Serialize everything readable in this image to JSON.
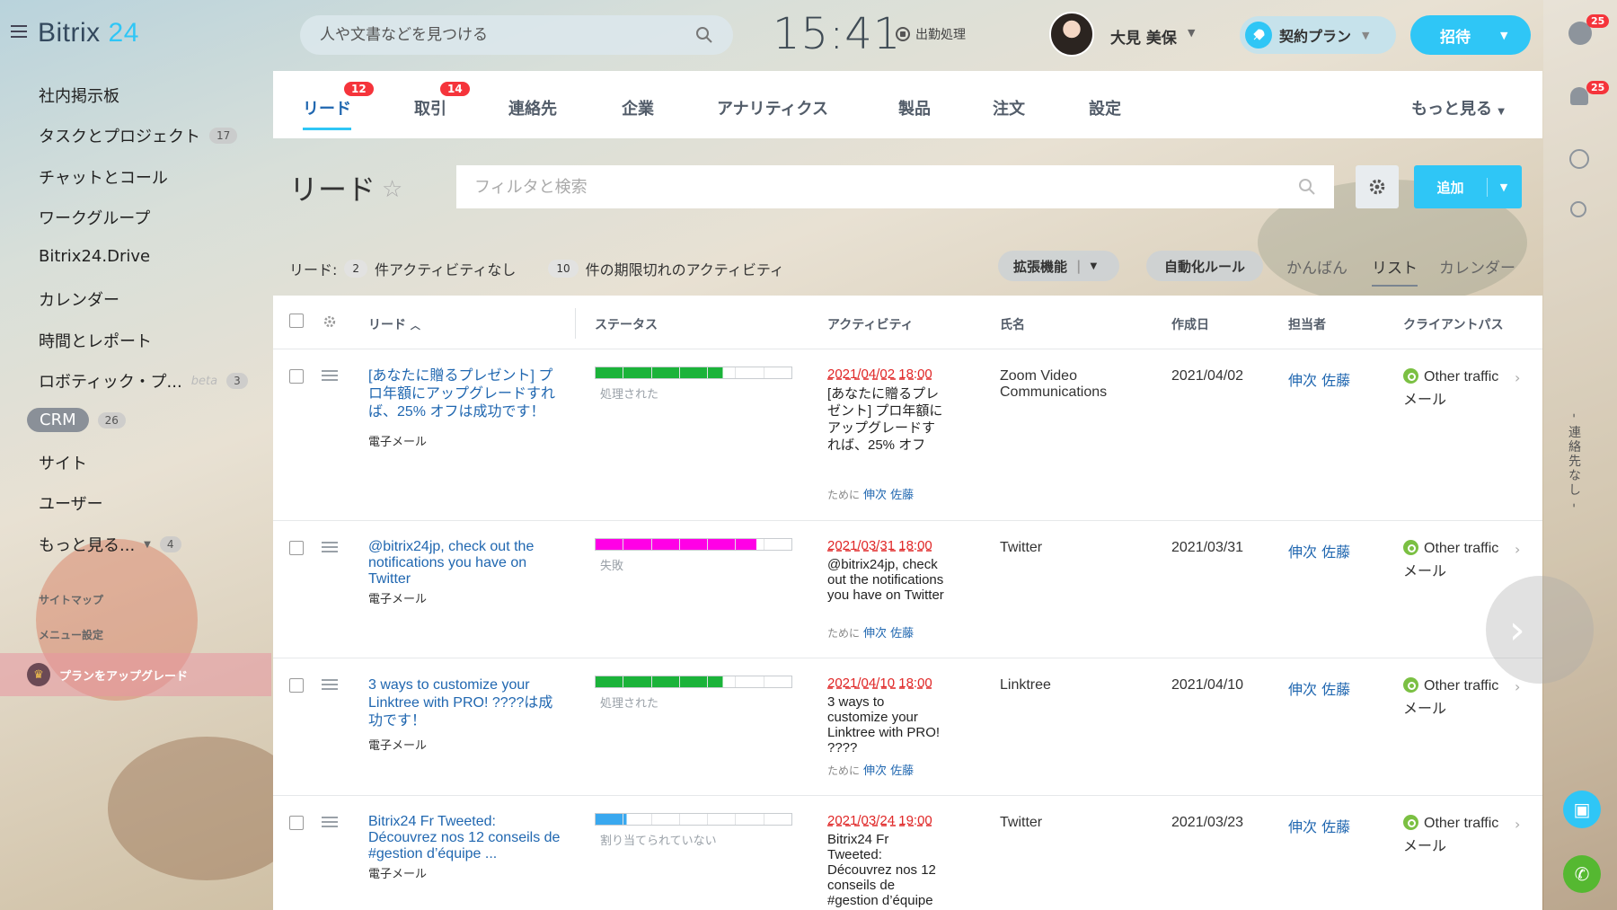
{
  "app": {
    "logo_text": "Bitrix",
    "logo_num": "24"
  },
  "header": {
    "search_placeholder": "人や文書などを見つける",
    "clock": "15:41",
    "clockin_label": "出勤処理",
    "user_name": "大見 美保",
    "plan_label": "契約プラン",
    "invite_label": "招待"
  },
  "right_rail": {
    "help_badge": "25",
    "notify_badge": "25",
    "vertical_text": "- 連絡先なし -"
  },
  "sidebar": {
    "items": [
      {
        "label": "社内掲示板"
      },
      {
        "label": "タスクとプロジェクト",
        "count": "17"
      },
      {
        "label": "チャットとコール"
      },
      {
        "label": "ワークグループ"
      },
      {
        "label": "Bitrix24.Drive"
      },
      {
        "label": "カレンダー"
      },
      {
        "label": "時間とレポート"
      },
      {
        "label": "ロボティック・プ...",
        "beta": "beta",
        "count": "3"
      },
      {
        "label": "CRM",
        "count": "26"
      },
      {
        "label": "サイト"
      },
      {
        "label": "ユーザー"
      },
      {
        "label": "もっと見る...",
        "count": "4"
      }
    ],
    "sitemap": "サイトマップ",
    "menu_settings": "メニュー設定",
    "upgrade": "プランをアップグレード"
  },
  "tabs": [
    {
      "label": "リード",
      "badge": "12"
    },
    {
      "label": "取引",
      "badge": "14"
    },
    {
      "label": "連絡先"
    },
    {
      "label": "企業"
    },
    {
      "label": "アナリティクス"
    },
    {
      "label": "製品"
    },
    {
      "label": "注文"
    },
    {
      "label": "設定"
    },
    {
      "label": "もっと見る"
    }
  ],
  "page": {
    "title": "リード",
    "filter_placeholder": "フィルタと検索",
    "add_label": "追加",
    "counters": {
      "prefix": "リード:",
      "no_activity_count": "2",
      "no_activity_label": "件アクティビティなし",
      "overdue_count": "10",
      "overdue_label": "件の期限切れのアクティビティ"
    },
    "ext_label": "拡張機能",
    "automation_label": "自動化ルール",
    "views": [
      "かんばん",
      "リスト",
      "カレンダー"
    ]
  },
  "grid": {
    "columns": [
      "リード",
      "ステータス",
      "アクティビティ",
      "氏名",
      "作成日",
      "担当者",
      "クライアントパス"
    ],
    "rows": [
      {
        "title": "[あなたに贈るプレゼント] プロ年額にアップグレードすれば、25% オフは成功です！",
        "type": "電子メール",
        "status": "処理された",
        "status_color": "#1bb33a",
        "progress": 0.65,
        "act_date": "2021/04/02 18:00",
        "act_text": "[あなたに贈るプレゼント] プロ年額にアップグレードすれば、25% オフ",
        "act_for": "ために",
        "act_owner": "伸次 佐藤",
        "name": "Zoom Video Communications",
        "created": "2021/04/02",
        "owner": "伸次 佐藤",
        "client": "Other traffic",
        "client_sub": "メール"
      },
      {
        "title": "@bitrix24jp, check out the notifications you have on Twitter",
        "type": "電子メール",
        "status": "失敗",
        "status_color": "#ff00e6",
        "progress": 0.82,
        "act_date": "2021/03/31 18:00",
        "act_text": "@bitrix24jp, check out the notifications you have on Twitter",
        "act_for": "ために",
        "act_owner": "伸次 佐藤",
        "name": "Twitter",
        "created": "2021/03/31",
        "owner": "伸次 佐藤",
        "client": "Other traffic",
        "client_sub": "メール"
      },
      {
        "title": "3 ways to customize your Linktree with PRO! ????は成功です！",
        "type": "電子メール",
        "status": "処理された",
        "status_color": "#1bb33a",
        "progress": 0.65,
        "act_date": "2021/04/10 18:00",
        "act_text": "3 ways to customize your Linktree with PRO! ????",
        "act_for": "ために",
        "act_owner": "伸次 佐藤",
        "name": "Linktree",
        "created": "2021/04/10",
        "owner": "伸次 佐藤",
        "client": "Other traffic",
        "client_sub": "メール"
      },
      {
        "title": "Bitrix24 Fr Tweeted: Découvrez nos 12 conseils de #gestion d’équipe ...",
        "type": "電子メール",
        "status": "割り当てられていない",
        "status_color": "#39a8ef",
        "progress": 0.16,
        "act_date": "2021/03/24 19:00",
        "act_text": "Bitrix24 Fr Tweeted: Découvrez nos 12 conseils de #gestion d’équipe",
        "act_for": "",
        "act_owner": "",
        "name": "Twitter",
        "created": "2021/03/23",
        "owner": "伸次 佐藤",
        "client": "Other traffic",
        "client_sub": "メール"
      }
    ]
  }
}
